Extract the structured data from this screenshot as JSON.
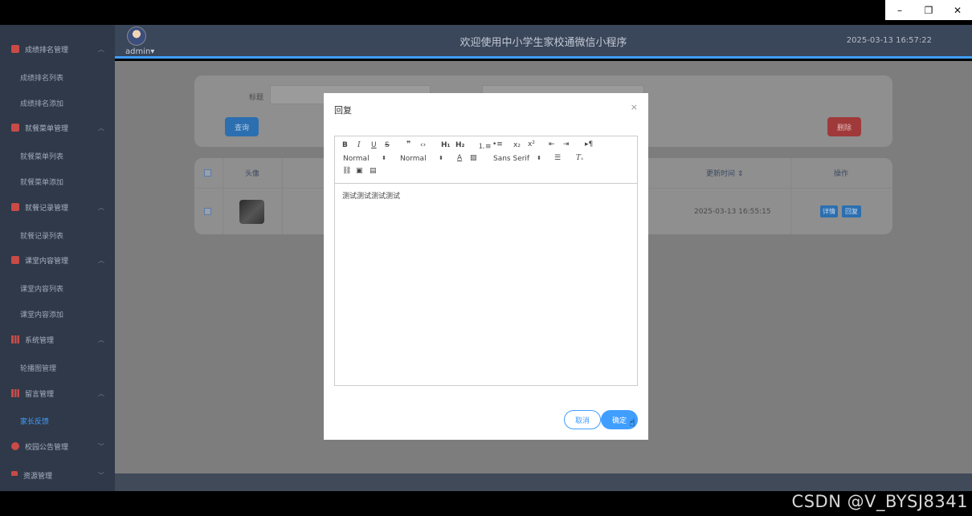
{
  "window": {
    "minimize": "–",
    "restore": "❐",
    "close": "✕"
  },
  "topbar": {
    "user": "admin",
    "user_caret": "▾",
    "title": "欢迎使用中小学生家校通微信小程序",
    "datetime": "2025-03-13 16:57:22"
  },
  "sidebar": {
    "groups": [
      {
        "label": "成绩排名管理",
        "icon": "check-icon",
        "color": "#e0524f",
        "items": [
          "成绩排名列表",
          "成绩排名添加"
        ]
      },
      {
        "label": "就餐菜单管理",
        "icon": "check-icon",
        "color": "#e0524f",
        "items": [
          "就餐菜单列表",
          "就餐菜单添加"
        ]
      },
      {
        "label": "就餐记录管理",
        "icon": "check-icon",
        "color": "#e0524f",
        "items": [
          "就餐记录列表"
        ]
      },
      {
        "label": "课堂内容管理",
        "icon": "check-icon",
        "color": "#e0524f",
        "items": [
          "课堂内容列表",
          "课堂内容添加"
        ]
      },
      {
        "label": "系统管理",
        "icon": "bar-chart-icon",
        "color": "#e0524f",
        "items": [
          "轮播图管理"
        ]
      },
      {
        "label": "留言管理",
        "icon": "bar-chart-icon",
        "color": "#e0524f",
        "items": [
          "家长反馈"
        ]
      },
      {
        "label": "校园公告管理",
        "icon": "info-icon",
        "color": "#e0524f",
        "items": []
      },
      {
        "label": "资源管理",
        "icon": "flag-icon",
        "color": "#e0524f",
        "items": []
      }
    ],
    "active_item": "家长反馈"
  },
  "search": {
    "title_label": "标题",
    "search_button": "查询",
    "delete_button": "删除"
  },
  "table": {
    "headers": {
      "avatar": "头像",
      "updated": "更新时间",
      "actions": "操作"
    },
    "rows": [
      {
        "updated": "2025-03-13 16:55:15",
        "detail": "详情",
        "reply": "回复"
      }
    ]
  },
  "modal": {
    "title": "回复",
    "close": "×",
    "header_picker": "Normal",
    "size_picker": "Normal",
    "font_picker": "Sans Serif",
    "content": "测试测试测试测试",
    "cancel": "取消",
    "confirm": "确定"
  },
  "watermark": "CSDN @V_BYSJ8341"
}
